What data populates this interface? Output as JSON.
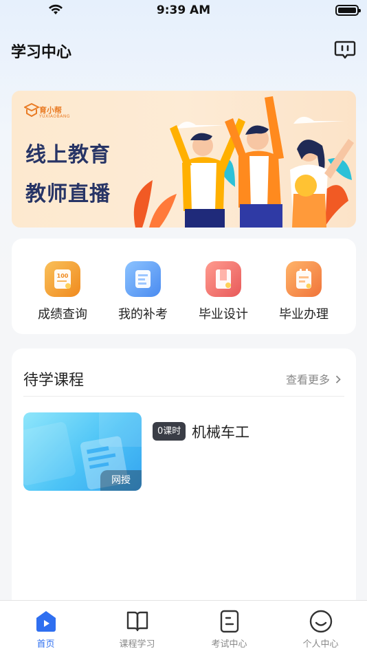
{
  "status_bar": {
    "time": "9:39 AM"
  },
  "header": {
    "title": "学习中心",
    "message_icon": "message-icon"
  },
  "banner": {
    "brand_name": "育小帮",
    "brand_sub": "YUXIAOBANG",
    "line1": "线上教育",
    "line2": "教师直播"
  },
  "quick_menu": [
    {
      "label": "成绩查询",
      "icon": "score-icon",
      "color": "#f3a02e"
    },
    {
      "label": "我的补考",
      "icon": "makeup-exam-icon",
      "color": "#5aa0f5"
    },
    {
      "label": "毕业设计",
      "icon": "design-icon",
      "color": "#ef6f6a"
    },
    {
      "label": "毕业办理",
      "icon": "graduation-icon",
      "color": "#f28a3b"
    }
  ],
  "courses": {
    "title": "待学课程",
    "more_label": "查看更多",
    "items": [
      {
        "lessons": "0课时",
        "name": "机械车工",
        "tag": "网授"
      }
    ]
  },
  "tabbar": [
    {
      "label": "首页",
      "icon": "home-icon",
      "active": true
    },
    {
      "label": "课程学习",
      "icon": "book-icon",
      "active": false
    },
    {
      "label": "考试中心",
      "icon": "exam-icon",
      "active": false
    },
    {
      "label": "个人中心",
      "icon": "profile-icon",
      "active": false
    }
  ],
  "colors": {
    "accent": "#2f6ff0",
    "banner_text": "#283566"
  }
}
